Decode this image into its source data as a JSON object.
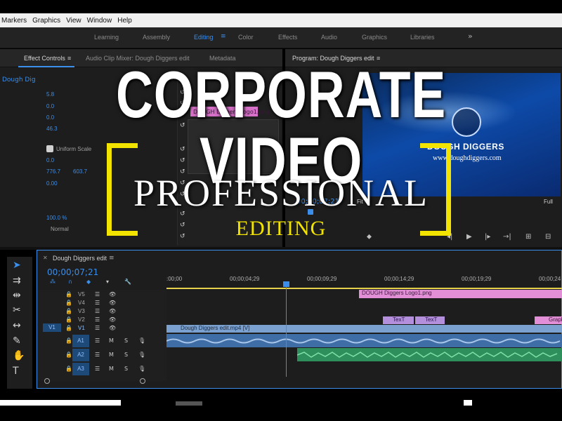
{
  "menubar": {
    "items": [
      "Markers",
      "Graphics",
      "View",
      "Window",
      "Help"
    ]
  },
  "workspaces": {
    "tabs": [
      {
        "label": "Learning",
        "active": false
      },
      {
        "label": "Assembly",
        "active": false
      },
      {
        "label": "Editing",
        "active": true
      },
      {
        "label": "Color",
        "active": false
      },
      {
        "label": "Effects",
        "active": false
      },
      {
        "label": "Audio",
        "active": false
      },
      {
        "label": "Graphics",
        "active": false
      },
      {
        "label": "Libraries",
        "active": false
      }
    ],
    "menu_icon": "≡",
    "more_icon": "»"
  },
  "left_panel": {
    "tabs": [
      "Effect Controls",
      "Audio Clip Mixer: Dough Diggers edit",
      "Metadata"
    ],
    "menu_icon": "≡",
    "sequence_label": "Dough Dig",
    "uniform_scale": "Uniform Scale",
    "values": [
      "0.0",
      "776.7",
      "603.7",
      "0.00",
      "100.0 %",
      "Normal",
      "5.8",
      "0.0",
      "0.0",
      "46.3"
    ],
    "clip_label": "DOUGH Diggers Logo1.png"
  },
  "program": {
    "tab": "Program: Dough Diggers edit",
    "brand": "DOUGH DIGGERS",
    "url": "www.doughdiggers.com",
    "timecode": "00;00;07;21",
    "fit": "Fit",
    "full": "Full"
  },
  "timeline": {
    "name": "Dough Diggers edit",
    "timecode": "00;00;07;21",
    "ruler": [
      ":00;00",
      "00;00;04;29",
      "00;00;09;29",
      "00;00;14;29",
      "00;00;19;29",
      "00;00;24"
    ],
    "video_tracks": [
      "V5",
      "V4",
      "V3",
      "V2",
      "V1"
    ],
    "audio_tracks": [
      "A1",
      "A2",
      "A3"
    ],
    "source_v1": "V1",
    "mute": "M",
    "solo": "S",
    "clips": {
      "logo": "DOUGH Diggers Logo1.png",
      "text1": "TexT",
      "text2": "TexT",
      "graphic": "Graph",
      "video": "Dough Diggers edit.mp4 [V]"
    }
  },
  "overlay": {
    "title": "CORPORATE VIDEO",
    "subtitle": "PROFESSIONAL",
    "editing": "EDITING",
    "title_color": "#ffffff",
    "accent_color": "#f2e300"
  },
  "icons": {
    "tools": [
      "selection-tool-icon",
      "track-select-icon",
      "ripple-edit-icon",
      "razor-icon",
      "slip-icon",
      "pen-icon",
      "hand-icon",
      "type-icon"
    ]
  }
}
